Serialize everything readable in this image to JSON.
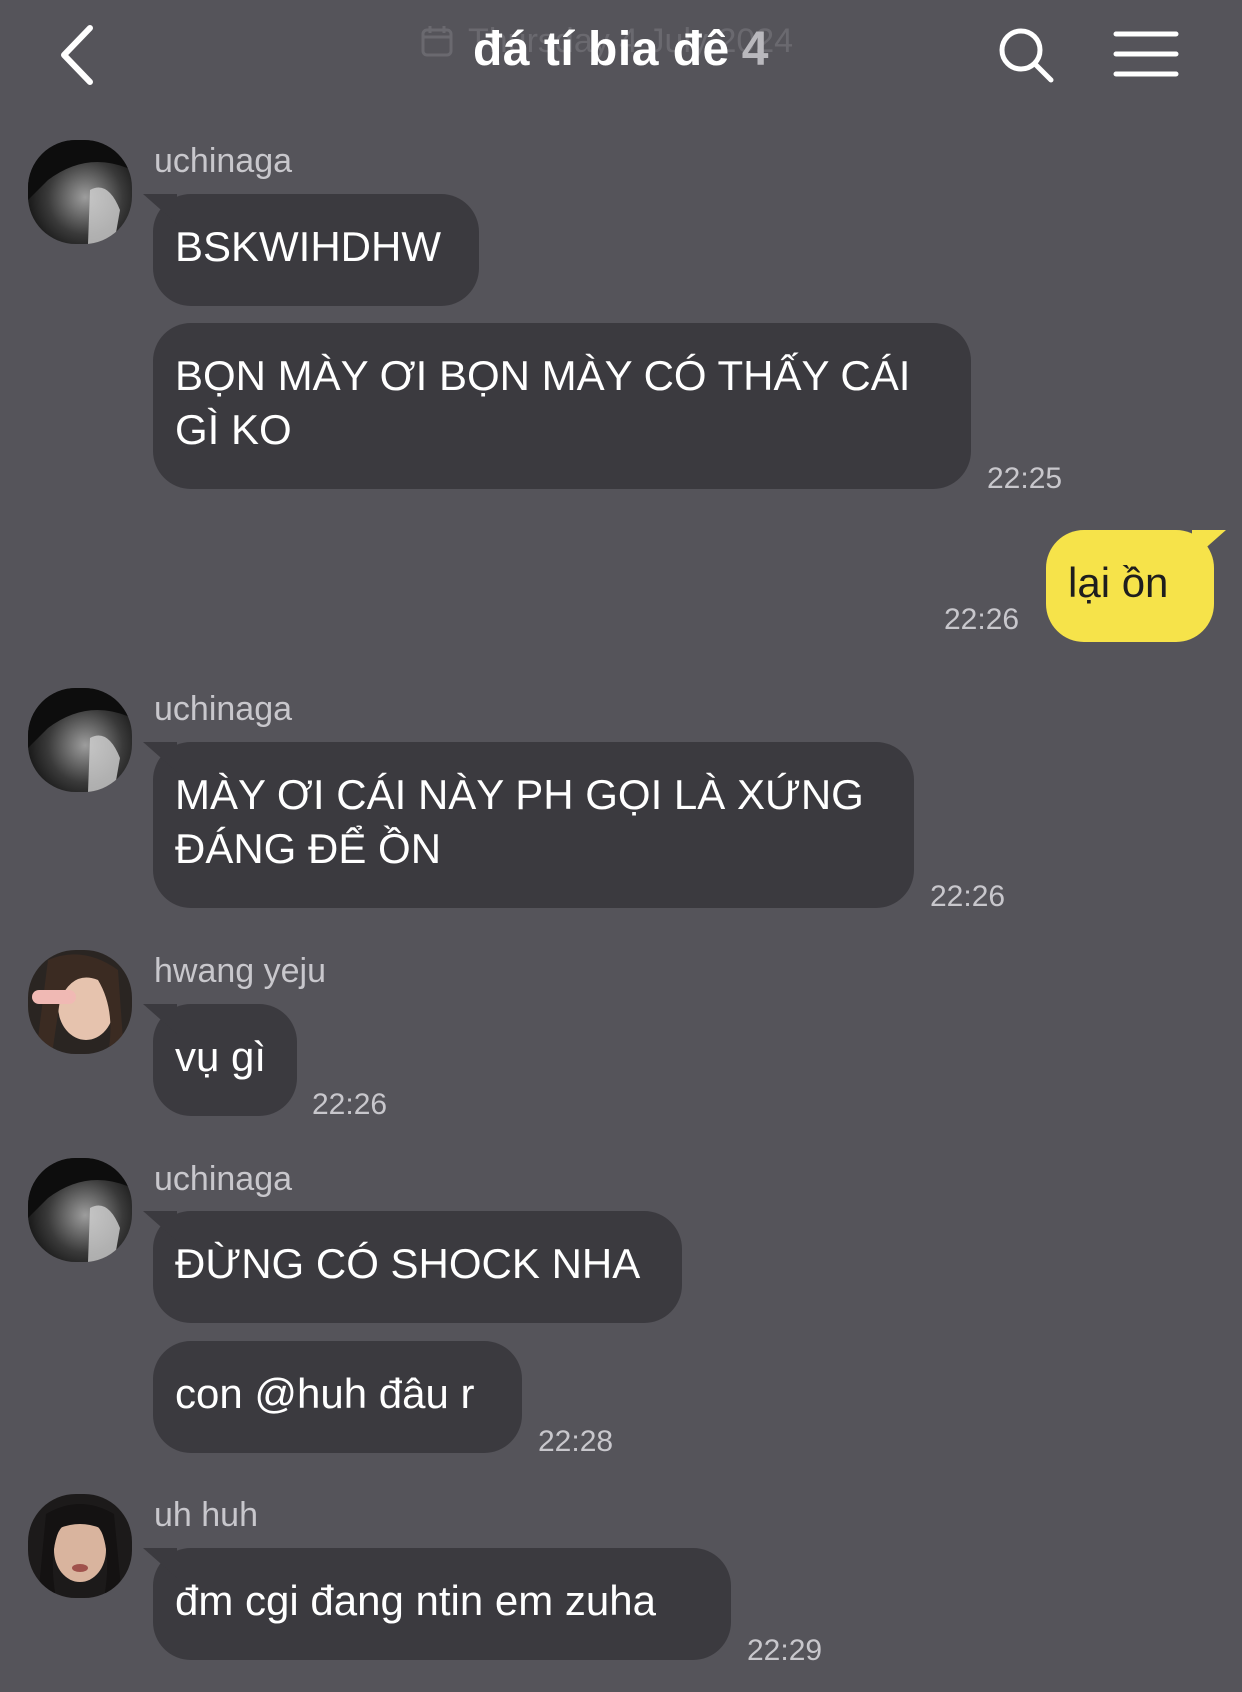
{
  "header": {
    "title": "đá tí bia đê",
    "member_count": "4",
    "faded_date": "Thursday 4 July 2024",
    "back_icon": "chevron-left-icon",
    "search_icon": "search-icon",
    "menu_icon": "hamburger-menu-icon"
  },
  "colors": {
    "background": "#55545a",
    "bubble_other": "#3b3a3f",
    "bubble_mine": "#f6e34a",
    "timestamp": "#c8c7cc"
  },
  "messages": [
    {
      "sender": "uchinaga",
      "text": "BSKWIHDHW"
    },
    {
      "sender": "uchinaga",
      "text": "BỌN MÀY ƠI BỌN MÀY CÓ THẤY CÁI GÌ KO",
      "time": "22:25"
    },
    {
      "sender": "me",
      "text": "lại ồn",
      "time": "22:26"
    },
    {
      "sender": "uchinaga",
      "text": "MÀY ƠI CÁI NÀY PH GỌI LÀ XỨNG ĐÁNG ĐỂ ỒN",
      "time": "22:26"
    },
    {
      "sender": "hwang yeju",
      "text": "vụ gì",
      "time": "22:26"
    },
    {
      "sender": "uchinaga",
      "text": "ĐỪNG CÓ SHOCK NHA"
    },
    {
      "sender": "uchinaga",
      "text": "con @huh đâu r",
      "time": "22:28"
    },
    {
      "sender": "uh huh",
      "text": "đm cgi đang ntin em zuha",
      "time": "22:29"
    }
  ]
}
